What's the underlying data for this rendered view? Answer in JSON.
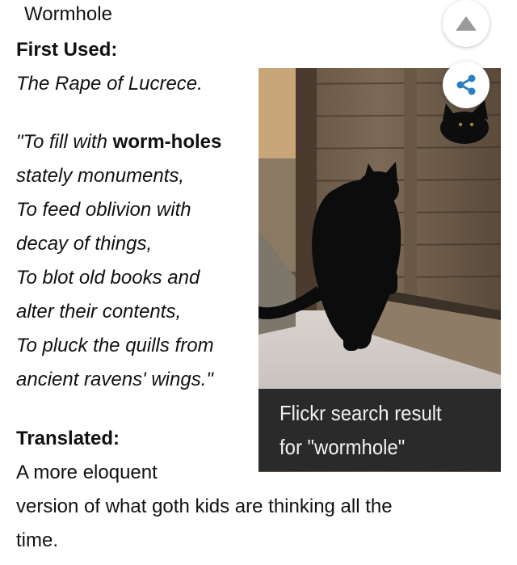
{
  "entry": {
    "word": "Wormhole",
    "first_used_label": "First Used:",
    "first_used_value": "The Rape of Lucrece.",
    "quote": {
      "l1_pre": "\"To fill with ",
      "l1_bold": "worm-holes",
      "l2": "stately monuments,",
      "l3": "To feed oblivion with",
      "l4": "decay of things,",
      "l5": "To blot old books and",
      "l6": "alter their contents,",
      "l7": "To pluck the quills from",
      "l8": "ancient ravens' wings.\""
    },
    "translated_label": "Translated:",
    "translated_l1": "A more eloquent",
    "translated_l2": "version of what goth kids are thinking all the",
    "translated_l3": "time."
  },
  "image": {
    "caption_l1": "Flickr search result",
    "caption_l2": "for \"wormhole\""
  },
  "controls": {
    "scroll_up_icon": "triangle-up-icon",
    "share_icon": "share-icon"
  },
  "colors": {
    "share_icon": "#2a7fc1",
    "up_icon": "#9a9a9a"
  }
}
